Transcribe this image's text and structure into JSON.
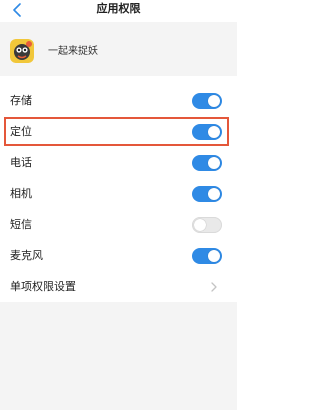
{
  "header": {
    "title": "应用权限",
    "back_icon": "chevron-left-icon"
  },
  "app": {
    "name": "一起来捉妖",
    "icon": "app-icon"
  },
  "permissions": [
    {
      "label": "存储",
      "enabled": true
    },
    {
      "label": "定位",
      "enabled": true
    },
    {
      "label": "电话",
      "enabled": true
    },
    {
      "label": "相机",
      "enabled": true
    },
    {
      "label": "短信",
      "enabled": false
    },
    {
      "label": "麦克风",
      "enabled": true
    }
  ],
  "settings_link": {
    "label": "单项权限设置",
    "icon": "chevron-right-icon"
  },
  "colors": {
    "accent": "#2f8ae5",
    "highlight": "#e4573a",
    "section_bg": "#f4f4f4"
  }
}
